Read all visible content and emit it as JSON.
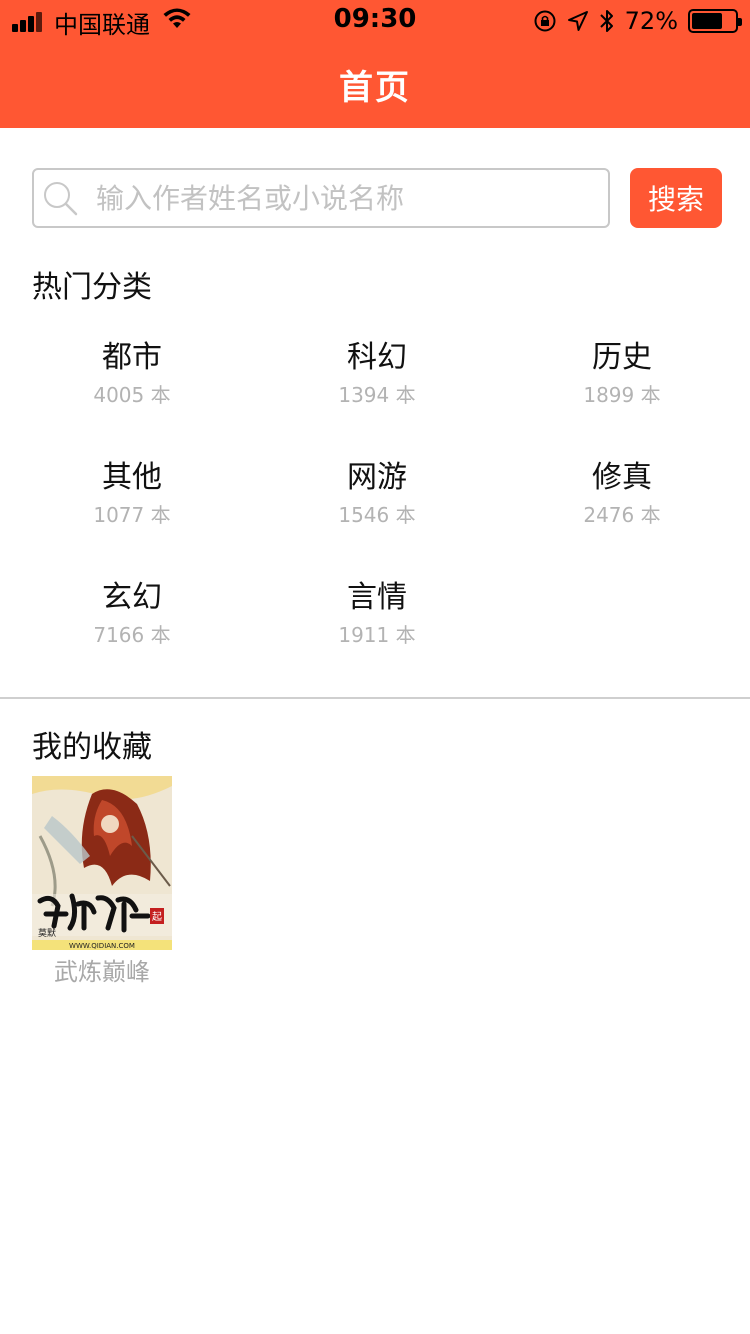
{
  "status_bar": {
    "carrier": "中国联通",
    "time": "09:30",
    "battery_percent": "72%",
    "battery_level": 0.72
  },
  "nav": {
    "title": "首页"
  },
  "search": {
    "placeholder": "输入作者姓名或小说名称",
    "value": "",
    "button_label": "搜索"
  },
  "hot_categories": {
    "title": "热门分类",
    "items": [
      {
        "name": "都市",
        "count": "4005 本"
      },
      {
        "name": "科幻",
        "count": "1394 本"
      },
      {
        "name": "历史",
        "count": "1899 本"
      },
      {
        "name": "其他",
        "count": "1077 本"
      },
      {
        "name": "网游",
        "count": "1546 本"
      },
      {
        "name": "修真",
        "count": "2476 本"
      },
      {
        "name": "玄幻",
        "count": "7166 本"
      },
      {
        "name": "言情",
        "count": "1911 本"
      }
    ]
  },
  "favorites": {
    "title": "我的收藏",
    "books": [
      {
        "title": "武炼巅峰",
        "cover_author": "莫默",
        "cover_url_text": "WWW.QIDIAN.COM",
        "cover_badge": "起"
      }
    ]
  },
  "colors": {
    "accent": "#ff5733",
    "muted_text": "#b3b3b3",
    "divider": "#cfcfcf"
  }
}
